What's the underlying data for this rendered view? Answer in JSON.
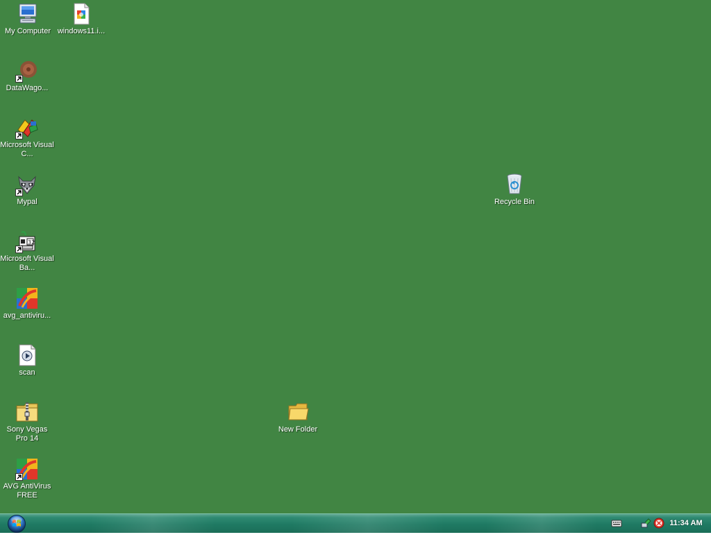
{
  "desktop": {
    "background_color": "#418543",
    "icons": [
      {
        "id": "my-computer",
        "label": "My Computer",
        "icon": "computer-icon"
      },
      {
        "id": "windows11",
        "label": "windows11.i...",
        "icon": "image-file-icon"
      },
      {
        "id": "datawagon",
        "label": "DataWago...",
        "icon": "datawagon-icon",
        "shortcut": true
      },
      {
        "id": "ms-visual-c",
        "label": "Microsoft Visual C...",
        "icon": "visual-c-icon",
        "shortcut": true
      },
      {
        "id": "mypal",
        "label": "Mypal",
        "icon": "raccoon-icon",
        "shortcut": true
      },
      {
        "id": "ms-visual-basic",
        "label": "Microsoft Visual Ba...",
        "icon": "visual-basic-icon",
        "shortcut": true
      },
      {
        "id": "avg-installer",
        "label": "avg_antiviru...",
        "icon": "avg-icon"
      },
      {
        "id": "scan",
        "label": "scan",
        "icon": "media-file-icon"
      },
      {
        "id": "sony-vegas",
        "label": "Sony Vegas Pro 14",
        "icon": "zip-folder-icon"
      },
      {
        "id": "avg-free",
        "label": "AVG AntiVirus FREE",
        "icon": "avg-icon",
        "shortcut": true
      },
      {
        "id": "recycle-bin",
        "label": "Recycle Bin",
        "icon": "recycle-bin-icon"
      },
      {
        "id": "new-folder",
        "label": "New Folder",
        "icon": "folder-icon"
      }
    ]
  },
  "taskbar": {
    "start_button": "start-orb-icon",
    "tray": [
      {
        "id": "keyboard",
        "icon": "keyboard-icon"
      },
      {
        "id": "network",
        "icon": "network-icon"
      },
      {
        "id": "avg-status",
        "icon": "avg-tray-icon"
      }
    ],
    "clock": "11:34 AM"
  }
}
